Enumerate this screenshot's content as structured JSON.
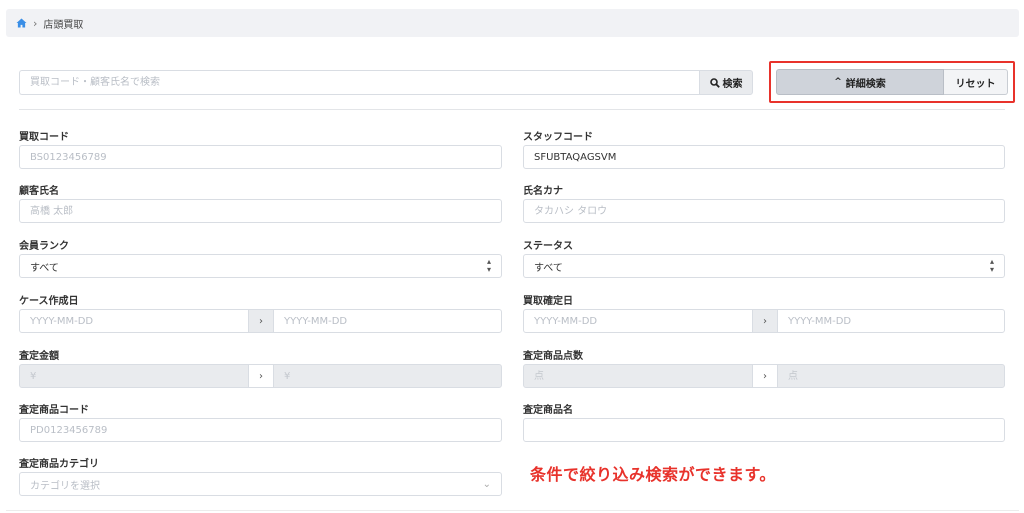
{
  "breadcrumb": {
    "current": "店頭買取"
  },
  "search": {
    "placeholder": "買取コード・顧客氏名で検索",
    "button_label": "検索"
  },
  "toolbar": {
    "advanced_label": "詳細検索",
    "reset_label": "リセット"
  },
  "form": {
    "purchase_code": {
      "label": "買取コード",
      "placeholder": "BS0123456789"
    },
    "staff_code": {
      "label": "スタッフコード",
      "value": "SFUBTAQAGSVM"
    },
    "customer_name": {
      "label": "顧客氏名",
      "placeholder": "高橋 太郎"
    },
    "name_kana": {
      "label": "氏名カナ",
      "placeholder": "タカハシ タロウ"
    },
    "member_rank": {
      "label": "会員ランク",
      "selected": "すべて"
    },
    "status": {
      "label": "ステータス",
      "selected": "すべて"
    },
    "case_created": {
      "label": "ケース作成日",
      "from_placeholder": "YYYY-MM-DD",
      "to_placeholder": "YYYY-MM-DD"
    },
    "purchase_confirmed": {
      "label": "買取確定日",
      "from_placeholder": "YYYY-MM-DD",
      "to_placeholder": "YYYY-MM-DD"
    },
    "appraisal_amount": {
      "label": "査定金額",
      "from_placeholder": "¥",
      "to_placeholder": "¥"
    },
    "appraisal_item_count": {
      "label": "査定商品点数",
      "from_placeholder": "点",
      "to_placeholder": "点"
    },
    "appraisal_item_code": {
      "label": "査定商品コード",
      "placeholder": "PD0123456789"
    },
    "appraisal_item_name": {
      "label": "査定商品名",
      "placeholder": ""
    },
    "appraisal_item_category": {
      "label": "査定商品カテゴリ",
      "placeholder": "カテゴリを選択"
    },
    "range_separator": "›"
  },
  "annotation": {
    "notice": "条件で絞り込み検索ができます。",
    "highlight_color": "#e8322b"
  },
  "icons": {
    "home": "home-icon",
    "search": "search-icon",
    "chevron_up": "chevron-up-icon",
    "select_arrows": "select-arrows-icon"
  }
}
